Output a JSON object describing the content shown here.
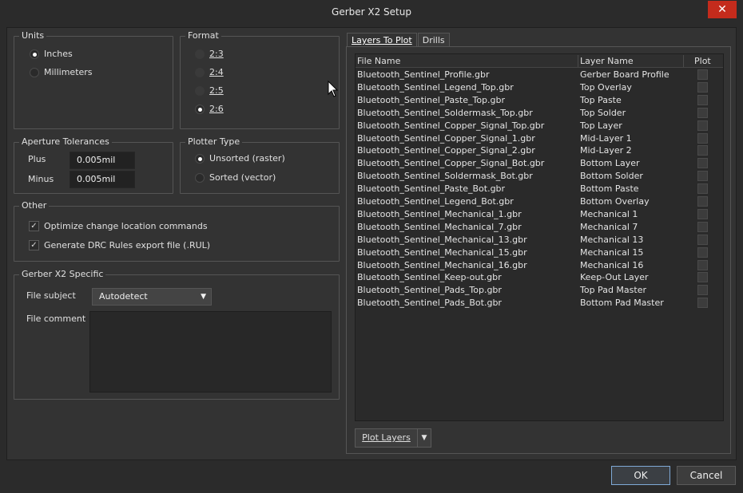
{
  "window": {
    "title": "Gerber X2 Setup",
    "close_glyph": "✕"
  },
  "units": {
    "title": "Units",
    "options": [
      {
        "label": "Inches",
        "selected": true
      },
      {
        "label": "Millimeters",
        "selected": false
      }
    ]
  },
  "format": {
    "title": "Format",
    "options": [
      {
        "label": "2:3",
        "selected": false
      },
      {
        "label": "2:4",
        "selected": false
      },
      {
        "label": "2:5",
        "selected": false
      },
      {
        "label": "2:6",
        "selected": true
      }
    ]
  },
  "aperture": {
    "title": "Aperture Tolerances",
    "plus_label": "Plus",
    "plus_value": "0.005mil",
    "minus_label": "Minus",
    "minus_value": "0.005mil"
  },
  "plotter": {
    "title": "Plotter Type",
    "options": [
      {
        "label": "Unsorted (raster)",
        "selected": true
      },
      {
        "label": "Sorted (vector)",
        "selected": false
      }
    ]
  },
  "other": {
    "title": "Other",
    "options": [
      {
        "label": "Optimize change location commands",
        "checked": true
      },
      {
        "label": "Generate DRC Rules export file (.RUL)",
        "checked": true
      }
    ]
  },
  "x2": {
    "title": "Gerber X2 Specific",
    "subject_label": "File subject",
    "subject_value": "Autodetect",
    "comment_label": "File comment"
  },
  "tabs": [
    {
      "label": "Layers To Plot",
      "active": true
    },
    {
      "label": "Drills",
      "active": false
    }
  ],
  "grid": {
    "columns": [
      "File Name",
      "Layer Name",
      "Plot"
    ],
    "rows": [
      [
        "Bluetooth_Sentinel_Profile.gbr",
        "Gerber Board Profile"
      ],
      [
        "Bluetooth_Sentinel_Legend_Top.gbr",
        "Top Overlay"
      ],
      [
        "Bluetooth_Sentinel_Paste_Top.gbr",
        "Top Paste"
      ],
      [
        "Bluetooth_Sentinel_Soldermask_Top.gbr",
        "Top Solder"
      ],
      [
        "Bluetooth_Sentinel_Copper_Signal_Top.gbr",
        "Top Layer"
      ],
      [
        "Bluetooth_Sentinel_Copper_Signal_1.gbr",
        "Mid-Layer 1"
      ],
      [
        "Bluetooth_Sentinel_Copper_Signal_2.gbr",
        "Mid-Layer 2"
      ],
      [
        "Bluetooth_Sentinel_Copper_Signal_Bot.gbr",
        "Bottom Layer"
      ],
      [
        "Bluetooth_Sentinel_Soldermask_Bot.gbr",
        "Bottom Solder"
      ],
      [
        "Bluetooth_Sentinel_Paste_Bot.gbr",
        "Bottom Paste"
      ],
      [
        "Bluetooth_Sentinel_Legend_Bot.gbr",
        "Bottom Overlay"
      ],
      [
        "Bluetooth_Sentinel_Mechanical_1.gbr",
        "Mechanical 1"
      ],
      [
        "Bluetooth_Sentinel_Mechanical_7.gbr",
        "Mechanical 7"
      ],
      [
        "Bluetooth_Sentinel_Mechanical_13.gbr",
        "Mechanical 13"
      ],
      [
        "Bluetooth_Sentinel_Mechanical_15.gbr",
        "Mechanical 15"
      ],
      [
        "Bluetooth_Sentinel_Mechanical_16.gbr",
        "Mechanical 16"
      ],
      [
        "Bluetooth_Sentinel_Keep-out.gbr",
        "Keep-Out Layer"
      ],
      [
        "Bluetooth_Sentinel_Pads_Top.gbr",
        "Top Pad Master"
      ],
      [
        "Bluetooth_Sentinel_Pads_Bot.gbr",
        "Bottom Pad Master"
      ]
    ]
  },
  "plot_layers_label": "Plot Layers",
  "buttons": {
    "ok": "OK",
    "cancel": "Cancel"
  },
  "colors": {
    "background": "#2b2b2b",
    "panel": "#333333",
    "close": "#c42b1c",
    "ok_border": "#7fa9d6"
  }
}
